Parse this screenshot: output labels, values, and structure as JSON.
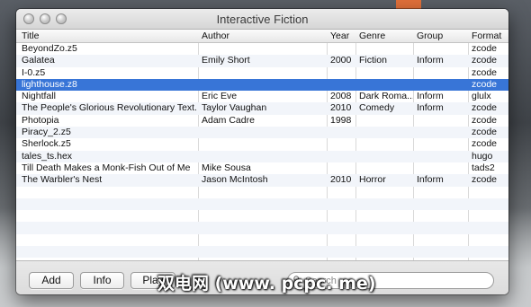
{
  "window": {
    "title": "Interactive Fiction"
  },
  "columns": {
    "title": "Title",
    "author": "Author",
    "year": "Year",
    "genre": "Genre",
    "group": "Group",
    "format": "Format"
  },
  "rows": [
    {
      "title": "BeyondZo.z5",
      "author": "",
      "year": "",
      "genre": "",
      "group": "",
      "format": "zcode"
    },
    {
      "title": "Galatea",
      "author": "Emily Short",
      "year": "2000",
      "genre": "Fiction",
      "group": "Inform",
      "format": "zcode"
    },
    {
      "title": "I-0.z5",
      "author": "",
      "year": "",
      "genre": "",
      "group": "",
      "format": "zcode"
    },
    {
      "title": "lighthouse.z8",
      "author": "",
      "year": "",
      "genre": "",
      "group": "",
      "format": "zcode"
    },
    {
      "title": "Nightfall",
      "author": "Eric Eve",
      "year": "2008",
      "genre": "Dark Roma...",
      "group": "Inform",
      "format": "glulx"
    },
    {
      "title": "The People's Glorious Revolutionary Text...",
      "author": "Taylor Vaughan",
      "year": "2010",
      "genre": "Comedy",
      "group": "Inform",
      "format": "zcode"
    },
    {
      "title": "Photopia",
      "author": "Adam Cadre",
      "year": "1998",
      "genre": "",
      "group": "",
      "format": "zcode"
    },
    {
      "title": "Piracy_2.z5",
      "author": "",
      "year": "",
      "genre": "",
      "group": "",
      "format": "zcode"
    },
    {
      "title": "Sherlock.z5",
      "author": "",
      "year": "",
      "genre": "",
      "group": "",
      "format": "zcode"
    },
    {
      "title": "tales_ts.hex",
      "author": "",
      "year": "",
      "genre": "",
      "group": "",
      "format": "hugo"
    },
    {
      "title": "Till Death Makes a Monk-Fish Out of Me",
      "author": "Mike Sousa",
      "year": "",
      "genre": "",
      "group": "",
      "format": "tads2"
    },
    {
      "title": "The Warbler's Nest",
      "author": "Jason McIntosh",
      "year": "2010",
      "genre": "Horror",
      "group": "Inform",
      "format": "zcode"
    }
  ],
  "selected_row": 3,
  "buttons": {
    "add": "Add",
    "info": "Info",
    "play": "Play"
  },
  "search": {
    "placeholder": "Search",
    "value": ""
  },
  "watermark": "双电网 (www. pcpc. me)",
  "colors": {
    "selection": "#3875d7",
    "alt_row": "#f2f5fa",
    "accent_orange": "#e0703a"
  },
  "icons": {
    "search": "magnifier-icon"
  }
}
